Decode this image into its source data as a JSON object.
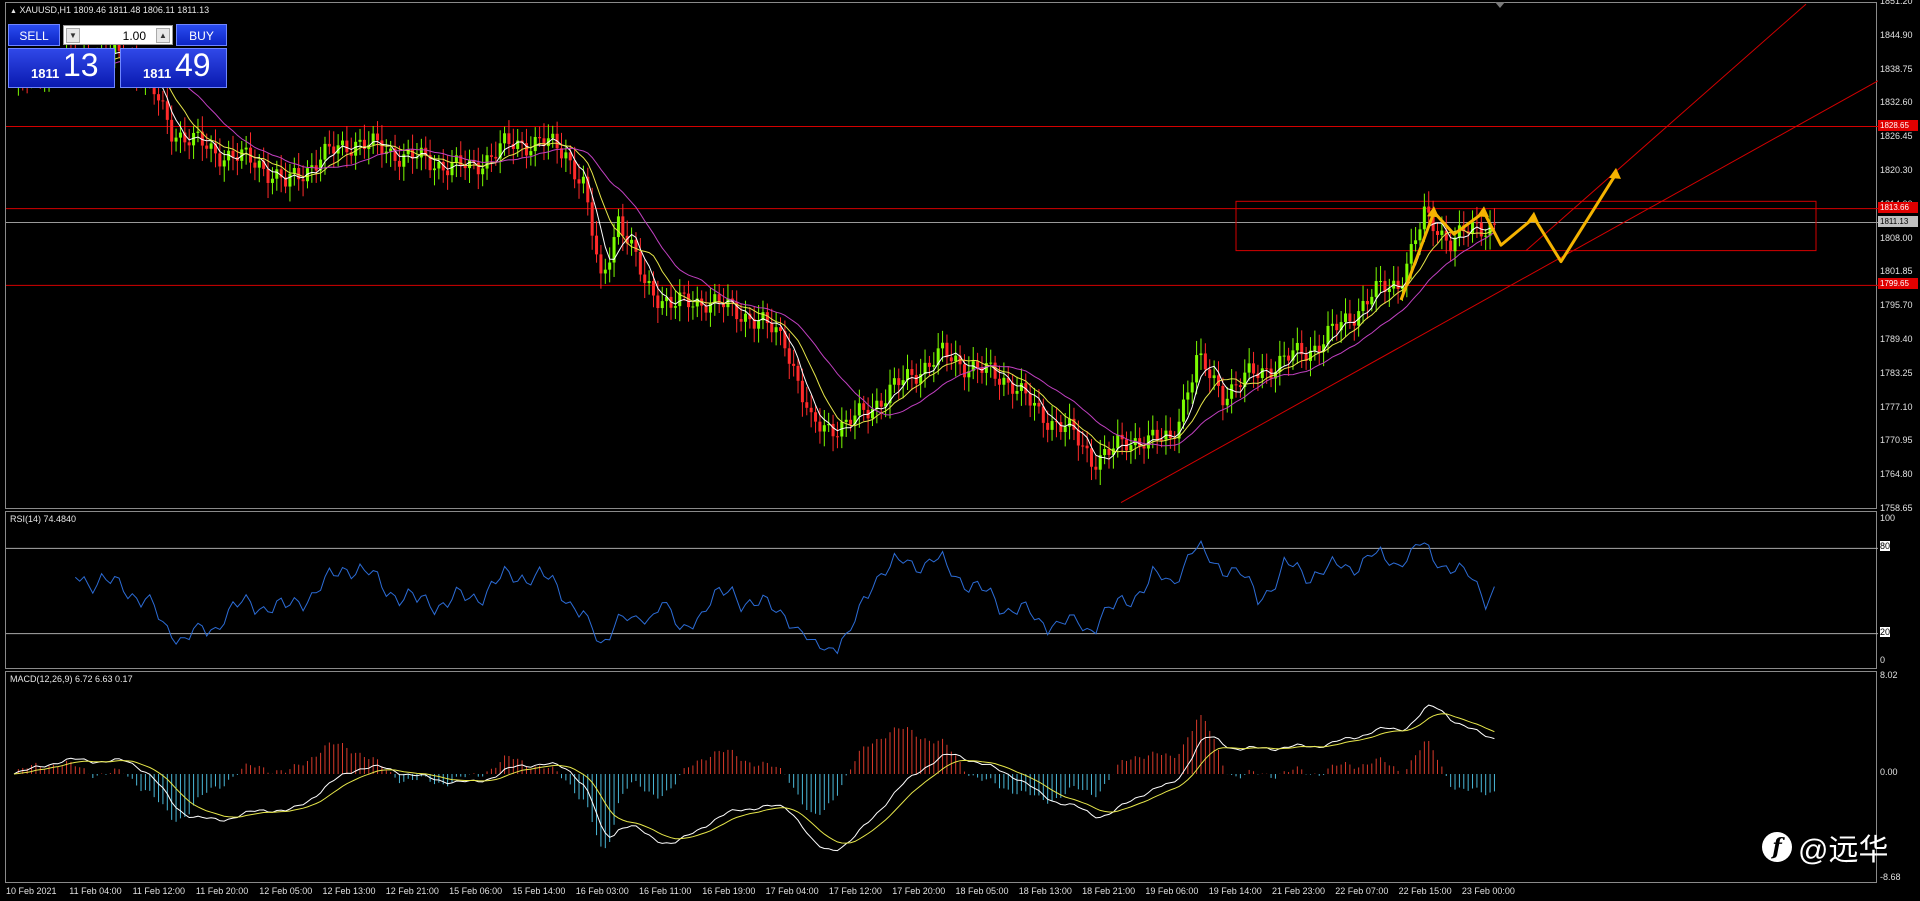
{
  "chart": {
    "symbol_label": "XAUUSD,H1  1809.46 1811.48 1806.11 1811.13",
    "price_axis": [
      "1851.20",
      "1844.90",
      "1838.75",
      "1832.60",
      "1826.45",
      "1820.30",
      "1814.00",
      "1808.00",
      "1801.85",
      "1795.70",
      "1789.40",
      "1783.25",
      "1777.10",
      "1770.95",
      "1764.80",
      "1758.65"
    ],
    "price_tags": [
      {
        "label": "1828.65",
        "color": "#e00000"
      },
      {
        "label": "1813.66",
        "color": "#e00000"
      },
      {
        "label": "1811.13",
        "color": "#c0c0c0"
      },
      {
        "label": "1799.65",
        "color": "#e00000"
      }
    ],
    "time_axis": [
      "10 Feb 2021",
      "11 Feb 04:00",
      "11 Feb 12:00",
      "11 Feb 20:00",
      "12 Feb 05:00",
      "12 Feb 13:00",
      "12 Feb 21:00",
      "15 Feb 06:00",
      "15 Feb 14:00",
      "16 Feb 03:00",
      "16 Feb 11:00",
      "16 Feb 19:00",
      "17 Feb 04:00",
      "17 Feb 12:00",
      "17 Feb 20:00",
      "18 Feb 05:00",
      "18 Feb 13:00",
      "18 Feb 21:00",
      "19 Feb 06:00",
      "19 Feb 14:00",
      "21 Feb 23:00",
      "22 Feb 07:00",
      "22 Feb 15:00",
      "23 Feb 00:00"
    ],
    "colors": {
      "bull": "#7cfc00",
      "bear": "#ff2a2a",
      "ma_fast": "#ffffff",
      "ma_mid": "#e6e64a",
      "ma_slow": "#c040c0",
      "level": "#d40000",
      "arrow": "#f5b300"
    }
  },
  "rsi": {
    "label": "RSI(14) 74.4840",
    "axis": [
      "100",
      "80",
      "20",
      "0"
    ],
    "color": "#2c6cd6"
  },
  "macd": {
    "label": "MACD(12,26,9) 6.72 6.63 0.17",
    "axis": [
      "8.02",
      "0.00",
      "-8.68"
    ],
    "colors": {
      "pos": "#d83a2a",
      "neg": "#4ab8d8",
      "main": "#ffffff",
      "signal": "#e6e64a"
    }
  },
  "trade_panel": {
    "sell_label": "SELL",
    "buy_label": "BUY",
    "lot": "1.00",
    "sell_small": "1811",
    "sell_big": "13",
    "buy_small": "1811",
    "buy_big": "49",
    "down_symbol": "▼",
    "up_symbol": "▲"
  },
  "watermark": {
    "mark": "f",
    "text": "@远华"
  }
}
